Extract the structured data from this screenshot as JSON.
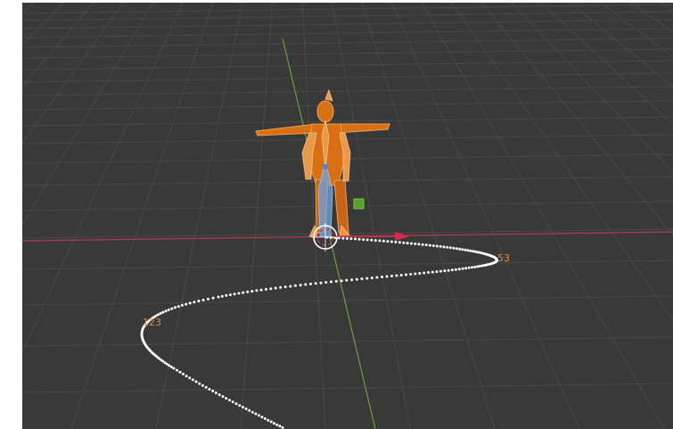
{
  "app": "3D viewport",
  "viewport": {
    "background": "#393939",
    "grid_color": "#4a4a4a",
    "x_axis_color": "#b23a48",
    "y_axis_color": "#6f9e3a"
  },
  "armature": {
    "mesh_color": "#d86f14",
    "bone_color": "#e89a4a",
    "selected_bone_color": "#6fa3e0"
  },
  "motion_path": {
    "dot_color": "#ffffff",
    "frame_labels": [
      {
        "text": "53"
      },
      {
        "text": "123"
      }
    ]
  },
  "gizmo": {
    "cursor_name": "3d-cursor",
    "x_arrow_color": "#e02a4a",
    "target_color": "#5aa02c"
  }
}
